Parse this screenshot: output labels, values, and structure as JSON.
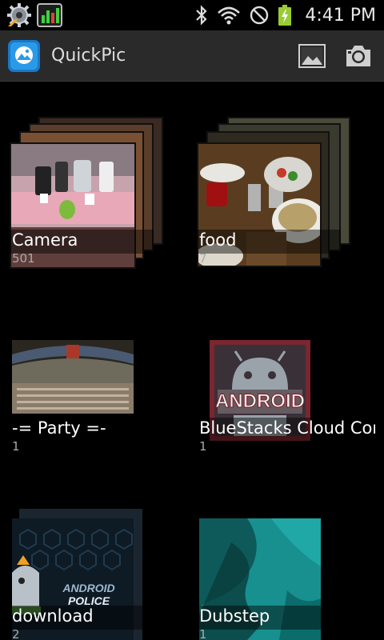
{
  "status_bar": {
    "time": "4:41 PM",
    "icons": [
      "settings-gear-icon",
      "activity-monitor-icon",
      "bluetooth-icon",
      "wifi-icon",
      "do-not-disturb-icon",
      "battery-charging-icon"
    ]
  },
  "action_bar": {
    "title": "QuickPic",
    "logo_icon": "quickpic-logo-icon",
    "actions": [
      "gallery-icon",
      "camera-icon"
    ]
  },
  "albums": [
    {
      "name": "Camera",
      "count": "501"
    },
    {
      "name": "food",
      "count": "7"
    },
    {
      "name": "-= Party =-",
      "count": "1"
    },
    {
      "name": "BlueStacks Cloud Con",
      "count": "1"
    },
    {
      "name": "download",
      "count": "2"
    },
    {
      "name": "Dubstep",
      "count": "1"
    }
  ],
  "thumb_text": {
    "android_sign": "ANDROID",
    "police_line1": "ANDROID",
    "police_line2": "POLICE"
  }
}
